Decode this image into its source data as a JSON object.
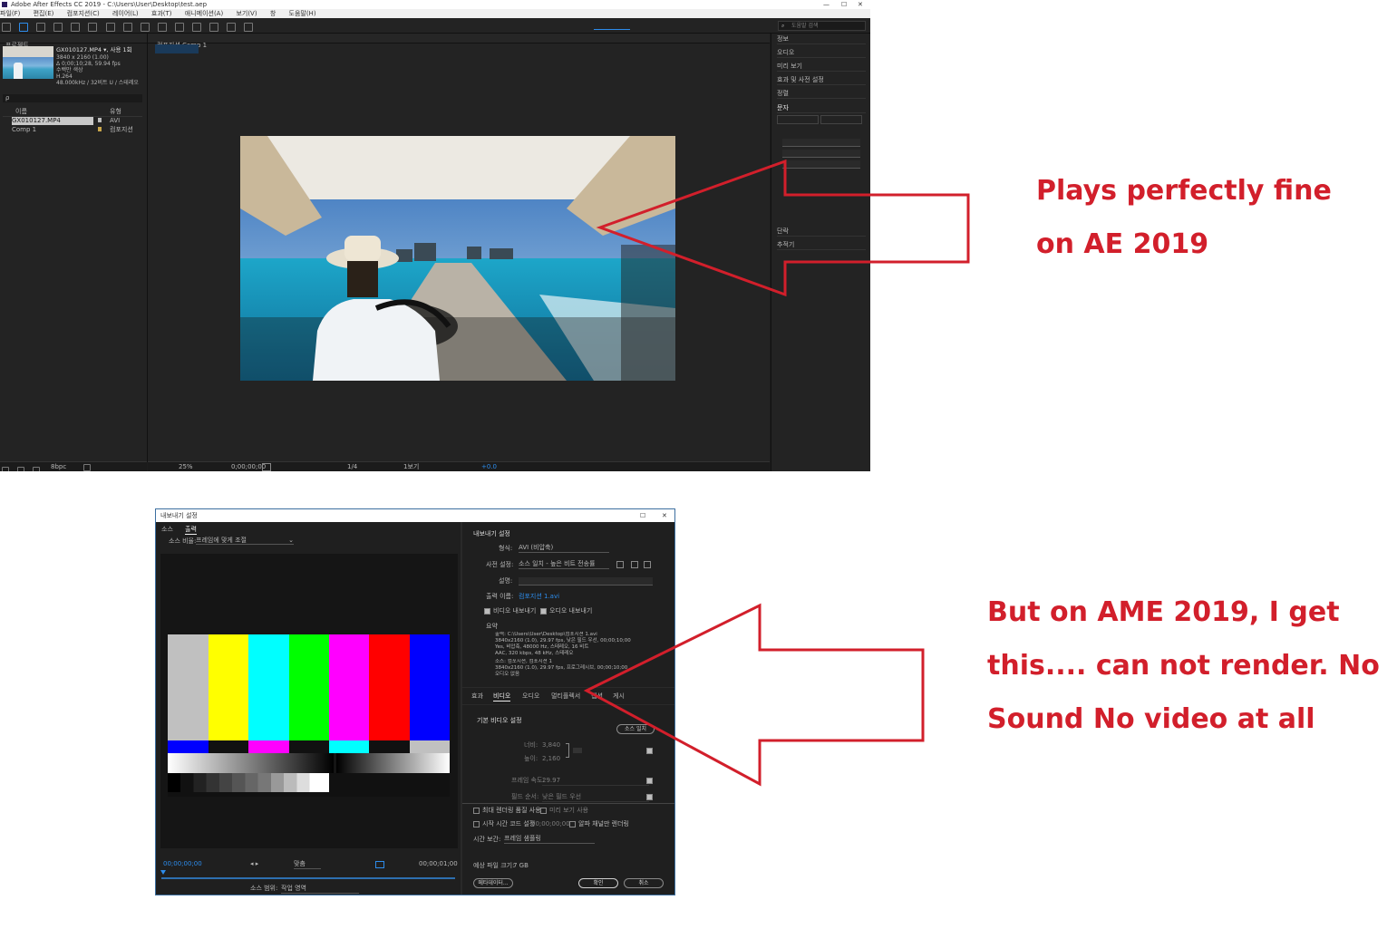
{
  "ae": {
    "title": "Adobe After Effects CC 2019 - C:\\Users\\User\\Desktop\\test.aep",
    "menu": [
      "파일(F)",
      "편집(E)",
      "컴포지션(C)",
      "레이어(L)",
      "효과(T)",
      "애니메이션(A)",
      "보기(V)",
      "창",
      "도움말(H)"
    ],
    "project": {
      "panel_label": "프로젝트",
      "footage_name": "GX010127.MP4 ▾, 사용 1회",
      "footage_res": "3840 x 2160 (1.00)",
      "footage_dur": "Δ 0;00;10;28, 59.94 fps",
      "footage_colors": "수백만 색상",
      "footage_codec": "H.264",
      "footage_audio": "48.000kHz / 32비트 U / 스테레오",
      "search_placeholder": "ρ",
      "col_name": "이름",
      "col_type": "유형",
      "rows": [
        {
          "name": "GX010127.MP4",
          "type": "AVI",
          "selected": true
        },
        {
          "name": "Comp 1",
          "type": "컴포지션",
          "selected": false
        }
      ],
      "bpc": "8bpc"
    },
    "viewer": {
      "tab": "컴포지션 Comp 1",
      "zoom": "25%",
      "timecode": "0;00;00;00",
      "resolution": "1/4",
      "views": "1보기",
      "offset": "+0.0"
    },
    "right_panel": {
      "search_placeholder": "도움말 검색",
      "items": [
        "정보",
        "오디오",
        "미리 보기",
        "효과 및 사전 설정",
        "정렬"
      ],
      "section_title": "문자",
      "lower_items": [
        "단락",
        "추적기"
      ]
    }
  },
  "ame": {
    "title": "내보내기 설정",
    "tabs": [
      "소스",
      "출력"
    ],
    "source_scaling_label": "소스 비율:",
    "source_scaling_value": "프레임에 맞게 조절",
    "time_start": "00;00;00;00",
    "time_end": "00;00;01;00",
    "fit_label": "맞춤",
    "source_range_label": "소스 범위:",
    "source_range_value": "작업 영역",
    "export_settings_title": "내보내기 설정",
    "format_label": "형식:",
    "format_value": "AVI (비압축)",
    "preset_label": "사전 설정:",
    "preset_value": "소스 일치 - 높은 비트 전송률",
    "comments_label": "설명:",
    "output_name_label": "출력 이름:",
    "output_name_value": "컴포지션 1.avi",
    "export_video_label": "비디오 내보내기",
    "export_audio_label": "오디오 내보내기",
    "summary_label": "요약",
    "summary_output_lines": [
      "출력: C:\\Users\\User\\Desktop\\컴포지션 1.avi",
      "3840x2160 (1.0), 29.97 fps, 낮은 필드 우선, 00;00;10;00",
      "Yes, 비압축, 48000 Hz, 스테레오, 16 비트",
      "AAC, 320 kbps, 48 kHz, 스테레오"
    ],
    "summary_source_lines": [
      "소스: 컴포지션, 컴포지션 1",
      "3840x2160 (1.0), 29.97 fps, 프로그레시브, 00;00;10;00",
      "오디오 없음"
    ],
    "sub_tabs": [
      "효과",
      "비디오",
      "오디오",
      "멀티플렉서",
      "캡션",
      "게시"
    ],
    "basic_video_title": "기본 비디오 설정",
    "match_source_btn": "소스 일치",
    "width_label": "너비:",
    "width_value": "3,840",
    "height_label": "높이:",
    "height_value": "2,160",
    "frame_rate_label": "프레임 속도:",
    "frame_rate_value": "29.97",
    "field_order_label": "필드 순서:",
    "field_order_value": "낮은 필드 우선",
    "use_max_render_quality": "최대 렌더링 품질 사용",
    "use_previews": "미리 보기 사용",
    "set_start_timecode": "시작 시간 코드 설정",
    "start_timecode_value": "00;00;00;00",
    "render_alpha_only": "알파 채널만 렌더링",
    "time_interpolation_label": "시간 보간:",
    "time_interpolation_value": "프레임 샘플링",
    "file_size_label": "예상 파일 크기:",
    "file_size_value": "7 GB",
    "metadata_btn": "메타데이터...",
    "ok_btn": "확인",
    "cancel_btn": "취소"
  },
  "annotations": {
    "top_line1": "Plays perfectly fine",
    "top_line2": "on AE 2019",
    "bottom_line1": "But on AME 2019, I get",
    "bottom_line2": "this.... can not render. No",
    "bottom_line3": "Sound No video at all",
    "arrow_color": "#d21f2b"
  },
  "colors": {
    "accent_blue": "#2d8ceb",
    "annotation_red": "#d21f2b",
    "bars_top": [
      "#c0c0c0",
      "#ffff00",
      "#00ffff",
      "#00ff00",
      "#ff00ff",
      "#ff0000",
      "#0000ff"
    ]
  }
}
